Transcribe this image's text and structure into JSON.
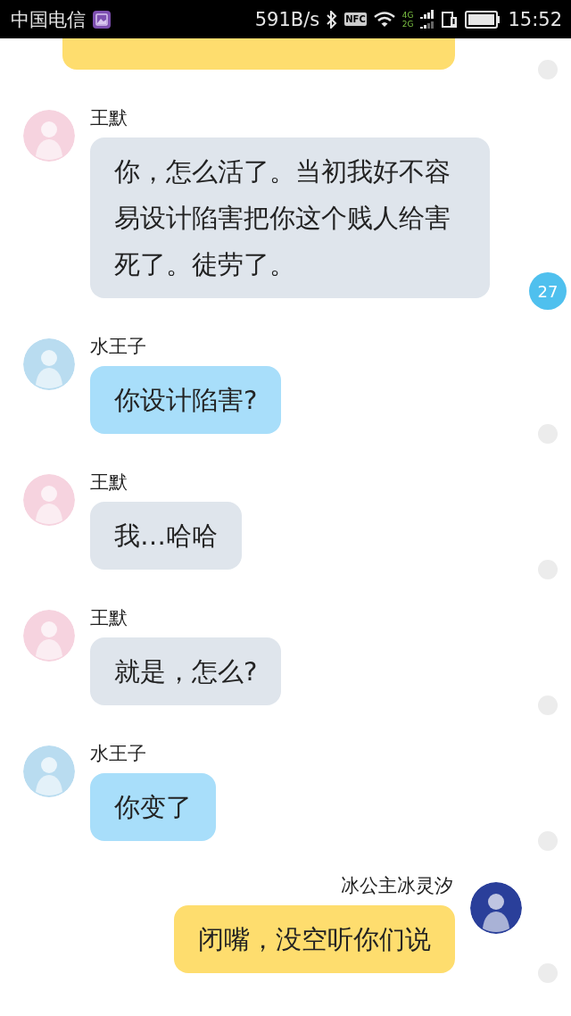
{
  "status_bar": {
    "carrier": "中国电信",
    "speed": "591B/s",
    "nfc": "NFC",
    "net_top": "4G",
    "net_bottom": "2G",
    "time": "15:52"
  },
  "messages": [
    {
      "kind": "outgoing",
      "cut": true,
      "color": "#fedd6e",
      "indicator": {
        "kind": "dot"
      }
    },
    {
      "kind": "incoming",
      "sender": "王默",
      "avatar": {
        "color": "#f6d3df"
      },
      "text": "你，怎么活了。当初我好不容易设计陷害把你这个贱人给害死了。徒劳了。",
      "color": "#dfe5ec",
      "indicator": {
        "kind": "badge",
        "text": "27"
      }
    },
    {
      "kind": "incoming",
      "sender": "水王子",
      "avatar": {
        "color": "#b9dcf0"
      },
      "text": "你设计陷害?",
      "color": "#a8defa",
      "indicator": {
        "kind": "dot"
      }
    },
    {
      "kind": "incoming",
      "sender": "王默",
      "avatar": {
        "color": "#f6d3df"
      },
      "text": "我…哈哈",
      "color": "#dfe5ec",
      "indicator": {
        "kind": "dot"
      }
    },
    {
      "kind": "incoming",
      "sender": "王默",
      "avatar": {
        "color": "#f6d3df"
      },
      "text": "就是，怎么?",
      "color": "#dfe5ec",
      "indicator": {
        "kind": "dot"
      }
    },
    {
      "kind": "incoming",
      "sender": "水王子",
      "avatar": {
        "color": "#b9dcf0"
      },
      "text": "你变了",
      "color": "#a8defa",
      "indicator": {
        "kind": "dot"
      }
    },
    {
      "kind": "outgoing",
      "sender": "冰公主冰灵汐",
      "avatar": {
        "color": "#2a3f9a"
      },
      "text": "闭嘴，没空听你们说",
      "color": "#fedd6e",
      "indicator": {
        "kind": "dot"
      }
    }
  ]
}
